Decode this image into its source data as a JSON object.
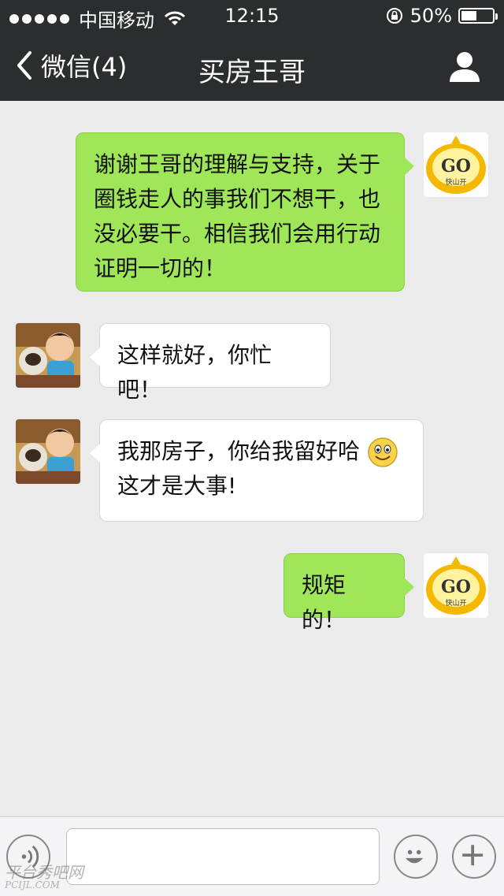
{
  "status_bar": {
    "carrier": "中国移动",
    "time": "12:15",
    "battery_percent": "50%",
    "battery_level": 0.5
  },
  "nav": {
    "back_label": "微信(4)",
    "title": "买房王哥"
  },
  "messages": [
    {
      "from": "me",
      "text": "谢谢王哥的理解与支持，关于圈钱走人的事我们不想干，也没必要干。相信我们会用行动证明一切的！"
    },
    {
      "from": "other",
      "text": "这样就好，你忙吧！"
    },
    {
      "from": "other",
      "text_line1": "我那房子，你给我留好哈",
      "text_line2": "这才是大事!"
    },
    {
      "from": "me",
      "text": "规矩的！"
    }
  ],
  "avatar_me": {
    "badge_text": "GO",
    "subtext": "快山开"
  },
  "watermark": {
    "main": "平台秀吧网",
    "sub": "PCIJL.COM"
  },
  "icons": [
    "back-chevron-icon",
    "profile-icon",
    "wifi-icon",
    "rotation-lock-icon",
    "battery-icon",
    "voice-icon",
    "emoji-icon",
    "plus-icon",
    "smiley-emoji-icon"
  ]
}
